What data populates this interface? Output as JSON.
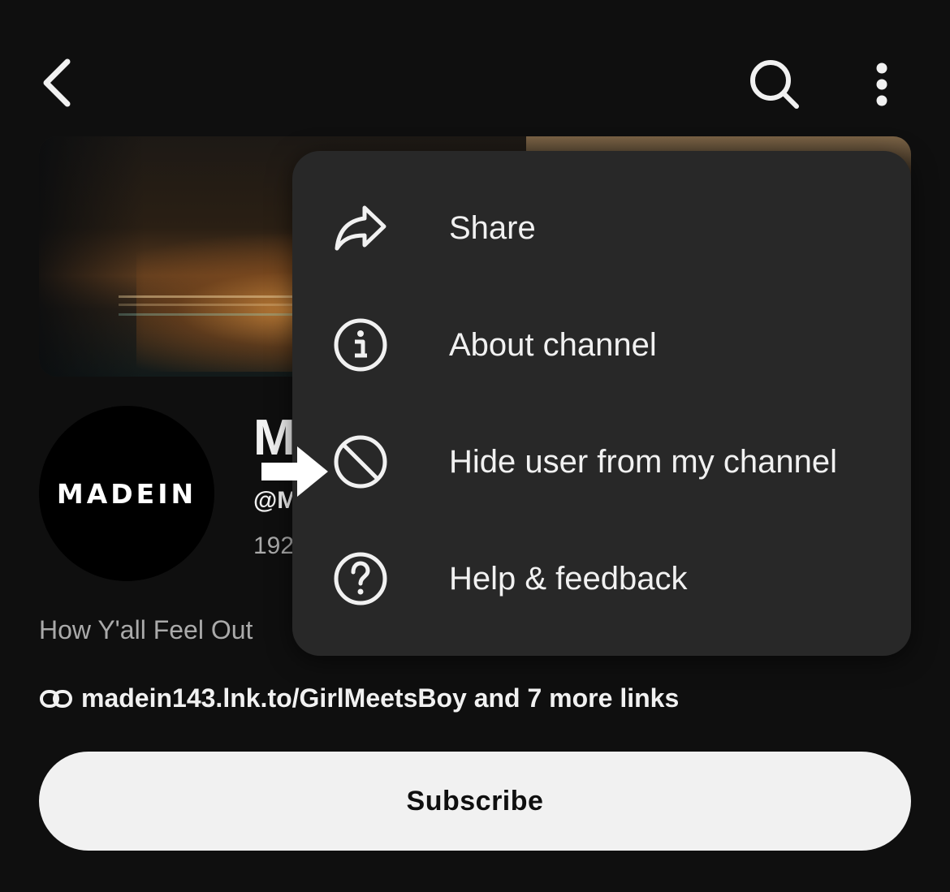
{
  "topbar": {
    "back_icon": "chevron-left-icon",
    "search_icon": "search-icon",
    "more_icon": "more-vertical-icon"
  },
  "channel": {
    "avatar_text": "MADEIN",
    "name_visible": "M",
    "handle_visible": "@M",
    "stats_visible": "192",
    "description_visible": "How Y'all Feel Out",
    "links_text": "madein143.lnk.to/GirlMeetsBoy and 7 more links",
    "link_icon": "link-icon"
  },
  "subscribe": {
    "label": "Subscribe"
  },
  "menu": {
    "items": [
      {
        "label": "Share",
        "icon": "share-icon"
      },
      {
        "label": "About channel",
        "icon": "info-icon"
      },
      {
        "label": "Hide user from my channel",
        "icon": "block-icon"
      },
      {
        "label": "Help & feedback",
        "icon": "help-icon"
      }
    ]
  },
  "annotation": {
    "icon": "pointer-arrow-icon"
  },
  "colors": {
    "background": "#0f0f0f",
    "menu_background": "#282828",
    "text_primary": "#f1f1f1",
    "text_secondary": "#aaaaaa",
    "subscribe_bg": "#f1f1f1"
  }
}
